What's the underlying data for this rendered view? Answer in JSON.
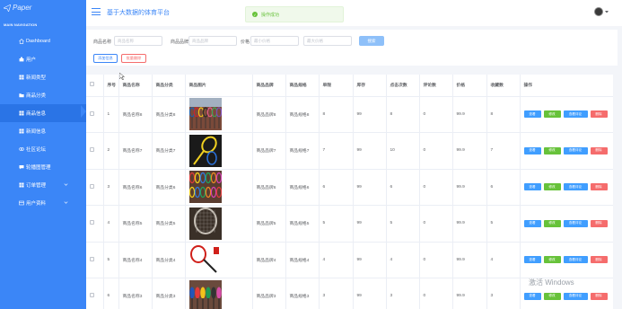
{
  "sidebar": {
    "logo_text": "Paper",
    "caption": "MAIN NAVIGATION",
    "items": [
      {
        "label": "Dashboard",
        "icon": "home-icon",
        "active": false,
        "expandable": false
      },
      {
        "label": "用户",
        "icon": "user-icon",
        "active": false,
        "expandable": false
      },
      {
        "label": "新闻类型",
        "icon": "grid-icon",
        "active": false,
        "expandable": false
      },
      {
        "label": "商品分类",
        "icon": "folder-icon",
        "active": false,
        "expandable": false
      },
      {
        "label": "商品信息",
        "icon": "grid-icon",
        "active": true,
        "expandable": false
      },
      {
        "label": "新闻信息",
        "icon": "grid-icon",
        "active": false,
        "expandable": false
      },
      {
        "label": "社区论坛",
        "icon": "link-icon",
        "active": false,
        "expandable": false
      },
      {
        "label": "轮播图管理",
        "icon": "comment-icon",
        "active": false,
        "expandable": false
      },
      {
        "label": "订单管理",
        "icon": "grid-icon",
        "active": false,
        "expandable": true
      },
      {
        "label": "用户资料",
        "icon": "card-icon",
        "active": false,
        "expandable": true
      }
    ]
  },
  "header": {
    "title": "基于大数据的体育平台",
    "toast": "操作成功"
  },
  "search": {
    "name_label": "商品名称",
    "name_placeholder": "商品名称",
    "brand_label": "商品品牌",
    "brand_placeholder": "商品品牌",
    "price_label": "价格",
    "min_price_placeholder": "最小价格",
    "max_price_placeholder": "最大价格",
    "search_button": "搜索",
    "add_button": "添加信息",
    "bulk_delete_button": "批量删除"
  },
  "table": {
    "columns": [
      "序号",
      "商品名称",
      "商品分类",
      "商品图片",
      "商品品牌",
      "商品规格",
      "单限",
      "库存",
      "点击次数",
      "评论数",
      "价格",
      "收藏数",
      "操作"
    ],
    "actions": {
      "view": "查看",
      "edit": "修改",
      "review": "查看评论",
      "delete": "删除"
    },
    "rows": [
      {
        "no": "1",
        "name": "商品名称8",
        "category": "商品分类8",
        "image": "rackets",
        "brand": "商品品牌8",
        "spec": "商品规格8",
        "limit": "8",
        "stock": "99",
        "clicks": "8",
        "comments": "0",
        "price": "99.9",
        "favorites": "8"
      },
      {
        "no": "2",
        "name": "商品名称7",
        "category": "商品分类7",
        "image": "yellow-racket",
        "brand": "商品品牌7",
        "spec": "商品规格7",
        "limit": "7",
        "stock": "99",
        "clicks": "10",
        "comments": "0",
        "price": "99.9",
        "favorites": "7"
      },
      {
        "no": "3",
        "name": "商品名称6",
        "category": "商品分类6",
        "image": "racket-rack",
        "brand": "商品品牌6",
        "spec": "商品规格6",
        "limit": "6",
        "stock": "99",
        "clicks": "6",
        "comments": "0",
        "price": "99.9",
        "favorites": "6"
      },
      {
        "no": "4",
        "name": "商品名称5",
        "category": "商品分类5",
        "image": "racket-closeup",
        "brand": "商品品牌5",
        "spec": "商品规格5",
        "limit": "5",
        "stock": "99",
        "clicks": "5",
        "comments": "0",
        "price": "99.9",
        "favorites": "5"
      },
      {
        "no": "5",
        "name": "商品名称4",
        "category": "商品分类4",
        "image": "red-racket",
        "brand": "商品品牌4",
        "spec": "商品规格4",
        "limit": "4",
        "stock": "99",
        "clicks": "4",
        "comments": "0",
        "price": "99.9",
        "favorites": "4"
      },
      {
        "no": "6",
        "name": "商品名称3",
        "category": "商品分类3",
        "image": "racket-shelf",
        "brand": "商品品牌3",
        "spec": "商品规格3",
        "limit": "3",
        "stock": "99",
        "clicks": "3",
        "comments": "0",
        "price": "99.9",
        "favorites": "3"
      }
    ]
  },
  "watermark": "激活 Windows",
  "colors": {
    "primary": "#3b86f7",
    "success": "#67c23a",
    "danger": "#f56c6c",
    "info": "#409eff"
  }
}
